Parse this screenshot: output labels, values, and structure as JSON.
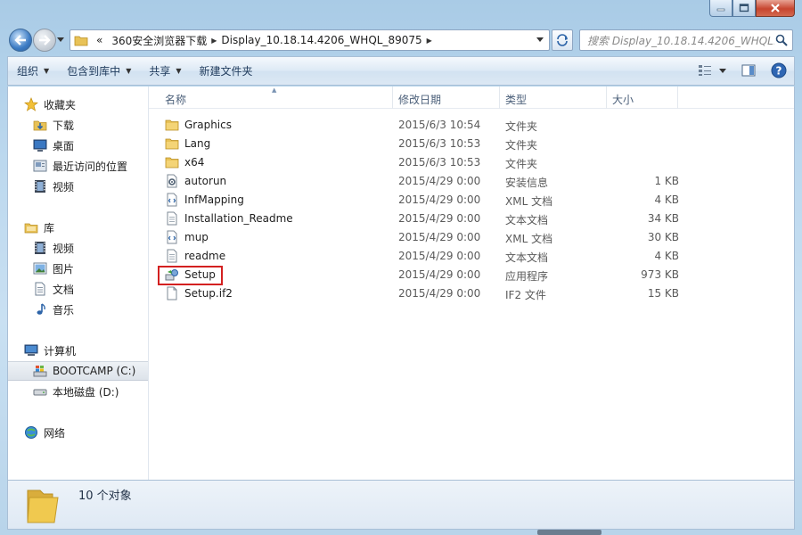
{
  "titlebar": {
    "buttons": [
      "minimize",
      "maximize",
      "close"
    ]
  },
  "address": {
    "overflow": "«",
    "segments": [
      "360安全浏览器下载",
      "Display_10.18.14.4206_WHQL_89075"
    ]
  },
  "search": {
    "placeholder": "搜索 Display_10.18.14.4206_WHQL..."
  },
  "toolbar": {
    "organize": "组织",
    "include_library": "包含到库中",
    "share": "共享",
    "new_folder": "新建文件夹"
  },
  "sidebar": {
    "favorites": {
      "label": "收藏夹",
      "items": [
        {
          "label": "下载",
          "icon": "download-folder-icon"
        },
        {
          "label": "桌面",
          "icon": "desktop-icon"
        },
        {
          "label": "最近访问的位置",
          "icon": "recent-places-icon"
        },
        {
          "label": "视频",
          "icon": "video-icon"
        }
      ]
    },
    "libraries": {
      "label": "库",
      "items": [
        {
          "label": "视频",
          "icon": "video-icon"
        },
        {
          "label": "图片",
          "icon": "pictures-icon"
        },
        {
          "label": "文档",
          "icon": "documents-icon"
        },
        {
          "label": "音乐",
          "icon": "music-icon"
        }
      ]
    },
    "computer": {
      "label": "计算机",
      "items": [
        {
          "label": "BOOTCAMP (C:)",
          "icon": "windows-drive-icon",
          "selected": true
        },
        {
          "label": "本地磁盘 (D:)",
          "icon": "hard-drive-icon"
        }
      ]
    },
    "network": {
      "label": "网络"
    }
  },
  "columns": {
    "name": "名称",
    "date": "修改日期",
    "type": "类型",
    "size": "大小"
  },
  "files": [
    {
      "name": "Graphics",
      "date": "2015/6/3 10:54",
      "type": "文件夹",
      "size": "",
      "icon": "folder"
    },
    {
      "name": "Lang",
      "date": "2015/6/3 10:53",
      "type": "文件夹",
      "size": "",
      "icon": "folder"
    },
    {
      "name": "x64",
      "date": "2015/6/3 10:53",
      "type": "文件夹",
      "size": "",
      "icon": "folder"
    },
    {
      "name": "autorun",
      "date": "2015/4/29 0:00",
      "type": "安装信息",
      "size": "1 KB",
      "icon": "setup-info"
    },
    {
      "name": "InfMapping",
      "date": "2015/4/29 0:00",
      "type": "XML 文档",
      "size": "4 KB",
      "icon": "xml"
    },
    {
      "name": "Installation_Readme",
      "date": "2015/4/29 0:00",
      "type": "文本文档",
      "size": "34 KB",
      "icon": "text"
    },
    {
      "name": "mup",
      "date": "2015/4/29 0:00",
      "type": "XML 文档",
      "size": "30 KB",
      "icon": "xml"
    },
    {
      "name": "readme",
      "date": "2015/4/29 0:00",
      "type": "文本文档",
      "size": "4 KB",
      "icon": "text"
    },
    {
      "name": "Setup",
      "date": "2015/4/29 0:00",
      "type": "应用程序",
      "size": "973 KB",
      "icon": "application",
      "highlighted": true
    },
    {
      "name": "Setup.if2",
      "date": "2015/4/29 0:00",
      "type": "IF2 文件",
      "size": "15 KB",
      "icon": "blank"
    }
  ],
  "status": {
    "count": "10 个对象"
  },
  "colors": {
    "highlight_border": "#d32020",
    "folder_yellow": "#e8c257",
    "frame_blue": "#bcd8ee"
  }
}
